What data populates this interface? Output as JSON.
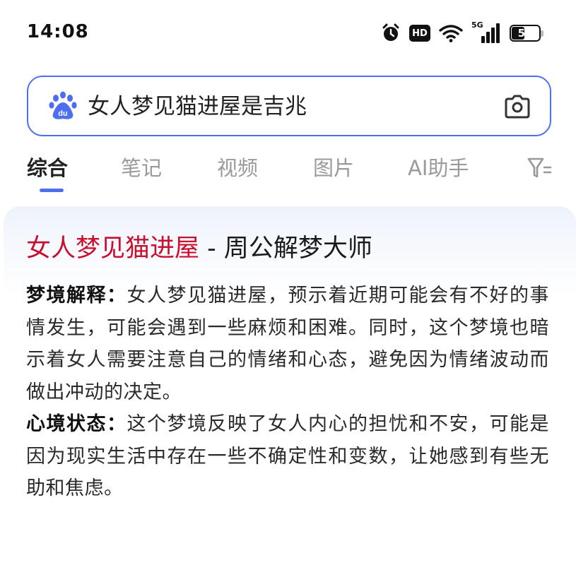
{
  "status_bar": {
    "time": "14:08",
    "network_label": "5G",
    "battery_level": "51",
    "battery_fraction": 0.51,
    "icons": [
      "alarm-clock-icon",
      "hd-icon",
      "wifi-icon",
      "signal-icon",
      "battery-icon"
    ]
  },
  "search": {
    "query": "女人梦见猫进屋是吉兆",
    "logo_icon": "baidu-paw-icon",
    "camera_icon": "camera-icon",
    "accent_color": "#4e6ef2"
  },
  "tabs": {
    "items": [
      {
        "label": "综合",
        "active": true
      },
      {
        "label": "笔记",
        "active": false
      },
      {
        "label": "视频",
        "active": false
      },
      {
        "label": "图片",
        "active": false
      },
      {
        "label": "AI助手",
        "active": false
      }
    ],
    "filter_icon": "filter-icon"
  },
  "result": {
    "title_highlight": "女人梦见猫进屋",
    "title_rest": " - 周公解梦大师",
    "highlight_color": "#c8102e",
    "paragraphs": [
      {
        "label": "梦境解释：",
        "text": "女人梦见猫进屋，预示着近期可能会有不好的事情发生，可能会遇到一些麻烦和困难。同时，这个梦境也暗示着女人需要注意自己的情绪和心态，避免因为情绪波动而做出冲动的决定。"
      },
      {
        "label": "心境状态：",
        "text": "这个梦境反映了女人内心的担忧和不安，可能是因为现实生活中存在一些不确定性和变数，让她感到有些无助和焦虑。"
      }
    ]
  }
}
